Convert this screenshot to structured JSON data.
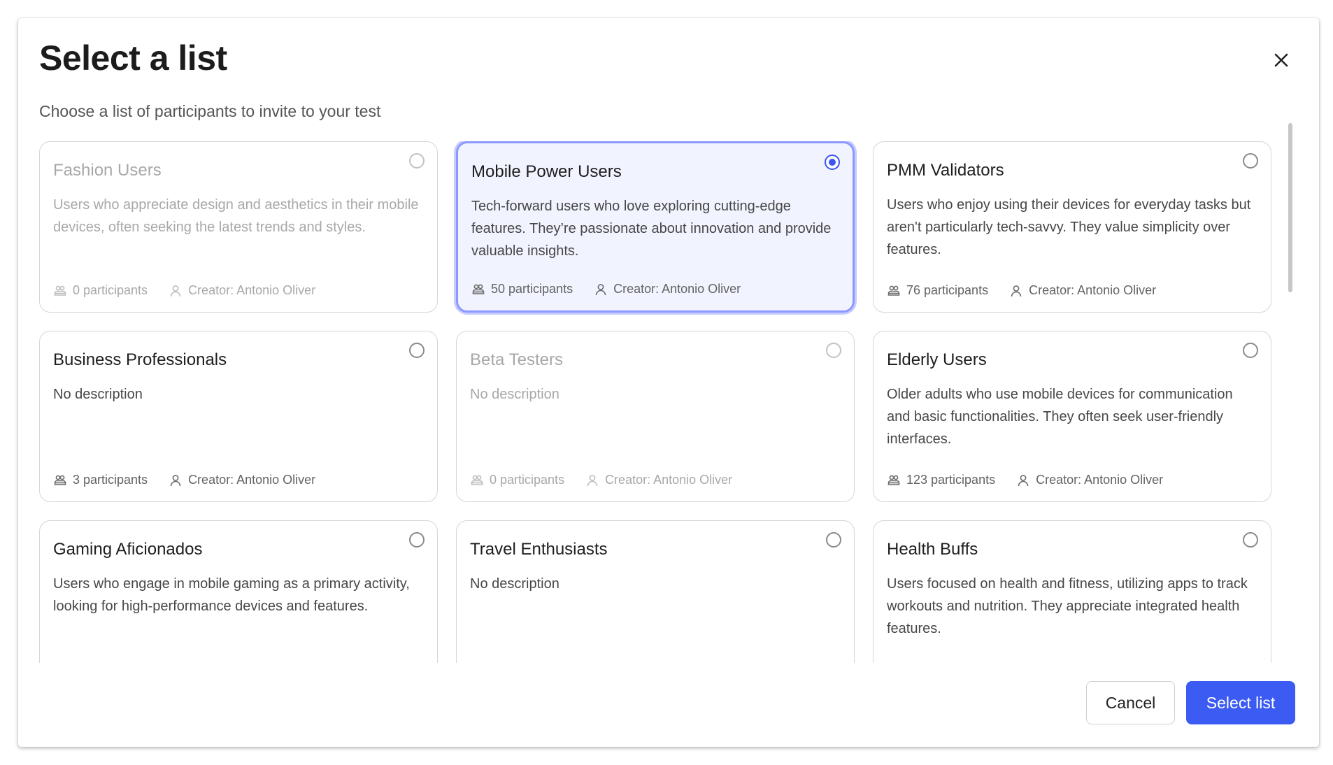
{
  "dialog": {
    "title": "Select a list",
    "subtitle": "Choose a list of participants to invite to your test",
    "close_icon": "close-icon"
  },
  "lists": [
    {
      "title": "Fashion Users",
      "description": "Users who appreciate design and aesthetics in their mobile devices, often seeking the latest trends and styles.",
      "participants": "0 participants",
      "creator": "Creator: Antonio Oliver",
      "state": "disabled",
      "selected": false
    },
    {
      "title": "Mobile Power Users",
      "description": "Tech-forward users who love exploring cutting-edge features. They’re passionate about innovation and provide valuable insights.",
      "participants": "50 participants",
      "creator": "Creator: Antonio Oliver",
      "state": "enabled",
      "selected": true
    },
    {
      "title": "PMM Validators",
      "description": "Users who enjoy using their devices for everyday tasks but aren't particularly tech-savvy. They value simplicity over features.",
      "participants": "76 participants",
      "creator": "Creator: Antonio Oliver",
      "state": "enabled",
      "selected": false
    },
    {
      "title": "Business Professionals",
      "description": "No description",
      "participants": "3 participants",
      "creator": "Creator: Antonio Oliver",
      "state": "enabled",
      "selected": false
    },
    {
      "title": "Beta Testers",
      "description": "No description",
      "participants": "0 participants",
      "creator": "Creator: Antonio Oliver",
      "state": "disabled",
      "selected": false
    },
    {
      "title": "Elderly Users",
      "description": "Older adults who use mobile devices for communication and basic functionalities. They often seek user-friendly interfaces.",
      "participants": "123 participants",
      "creator": "Creator: Antonio Oliver",
      "state": "enabled",
      "selected": false
    },
    {
      "title": "Gaming Aficionados",
      "description": "Users who engage in mobile gaming as a primary activity, looking for high-performance devices and features.",
      "participants": "",
      "creator": "",
      "state": "enabled",
      "selected": false
    },
    {
      "title": "Travel Enthusiasts",
      "description": "No description",
      "participants": "",
      "creator": "",
      "state": "enabled",
      "selected": false
    },
    {
      "title": "Health Buffs",
      "description": "Users focused on health and fitness, utilizing apps to track workouts and nutrition. They appreciate integrated health features.",
      "participants": "",
      "creator": "",
      "state": "enabled",
      "selected": false
    }
  ],
  "footer": {
    "cancel_label": "Cancel",
    "select_label": "Select list"
  },
  "colors": {
    "primary": "#3b5bf2",
    "selected_border": "#8d98ff",
    "selected_bg": "#f1f3ff"
  }
}
